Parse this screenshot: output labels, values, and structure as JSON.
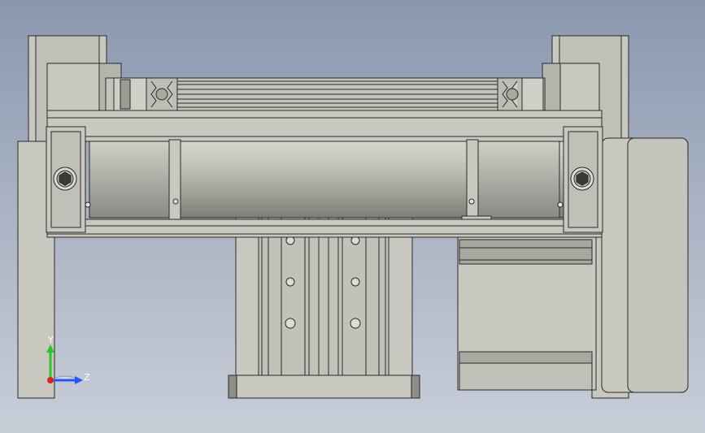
{
  "viewport": {
    "background_top": "#8a98ae",
    "background_bottom": "#c8ced8"
  },
  "model": {
    "body_color": "#c8c8c0",
    "shade_color": "#b4b4ac",
    "edge_color": "#2a2a2a",
    "parts": [
      "left-support-column",
      "right-support-column",
      "top-frame-plate",
      "lower-frame-bar",
      "horizontal-cylinder",
      "clamp-block-left",
      "clamp-block-right",
      "guide-rod-assembly",
      "vertical-slide-rail",
      "servo-motor"
    ]
  },
  "triad": {
    "y_label": "Y",
    "z_label": "Z",
    "y_color": "#22cc22",
    "z_color": "#2255ff",
    "x_color": "#dd2222"
  }
}
